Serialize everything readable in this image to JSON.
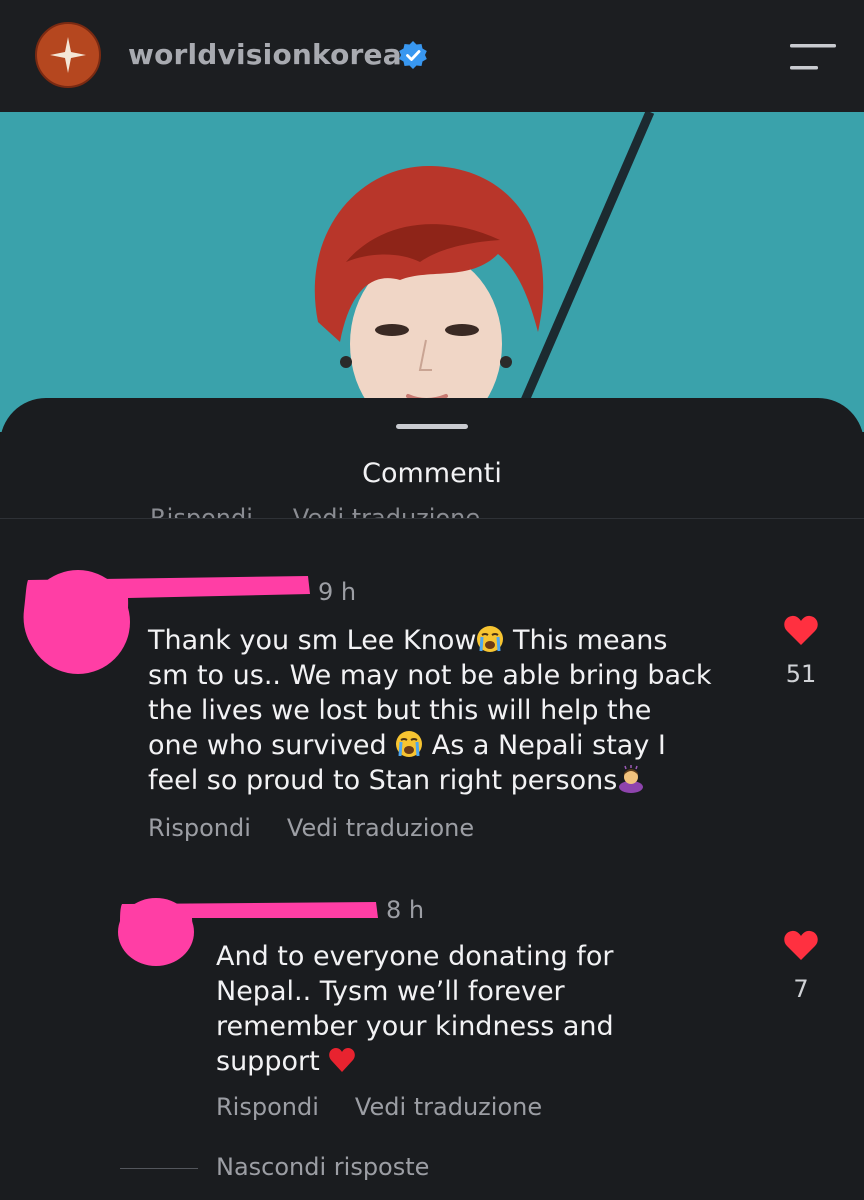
{
  "header": {
    "account_name": "worldvisionkorea",
    "logo_icon": "world-vision-star-icon",
    "verified_icon": "verified-badge-icon",
    "menu_icon": "menu-icon"
  },
  "post": {
    "image": "photo-person-red-hair-teal-background"
  },
  "sheet": {
    "title": "Commenti",
    "clipped_actions": [
      "Rispondi",
      "Vedi traduzione"
    ]
  },
  "comments": [
    {
      "time": "9 h",
      "lines": [
        "Thank you sm Lee Know",
        "sm to us.. We may not be able bring back",
        "the lives we lost but this will help the",
        "one who survived",
        "feel so proud to Stan right persons"
      ],
      "line1_suffix": " This means",
      "line4_suffix": " As a Nepali stay I",
      "likes": "51",
      "reply_label": "Rispondi",
      "translate_label": "Vedi traduzione"
    },
    {
      "time": "8 h",
      "lines": [
        "And to everyone donating for",
        "Nepal.. Tysm we’ll forever",
        "remember your kindness and",
        "support"
      ],
      "likes": "7",
      "reply_label": "Rispondi",
      "translate_label": "Vedi traduzione"
    }
  ],
  "hide_replies_label": "Nascondi risposte",
  "colors": {
    "background": "#1a1c1f",
    "accent_like": "#ff3040",
    "redaction": "#ff3ea5",
    "photo_bg": "#3aa2ab",
    "verified": "#3897f0"
  }
}
